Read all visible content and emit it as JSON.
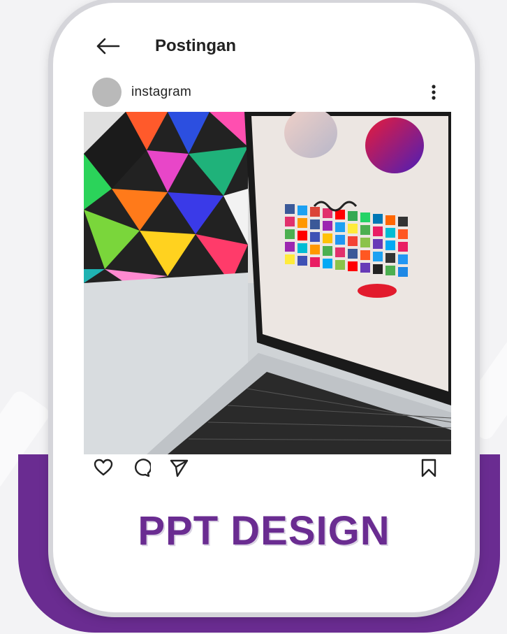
{
  "header": {
    "back_icon": "arrow-left-icon",
    "title": "Postingan"
  },
  "profile": {
    "username": "instagram",
    "more_icon": "more-vertical-icon"
  },
  "post": {
    "image_description_icons": [
      "heart-icon",
      "comment-icon",
      "send-icon",
      "bookmark-icon"
    ]
  },
  "brand": {
    "text": "PPT DESIGN"
  },
  "colors": {
    "accent": "#6a2c91",
    "card": "#ffffff",
    "background": "#f3f3f5"
  }
}
